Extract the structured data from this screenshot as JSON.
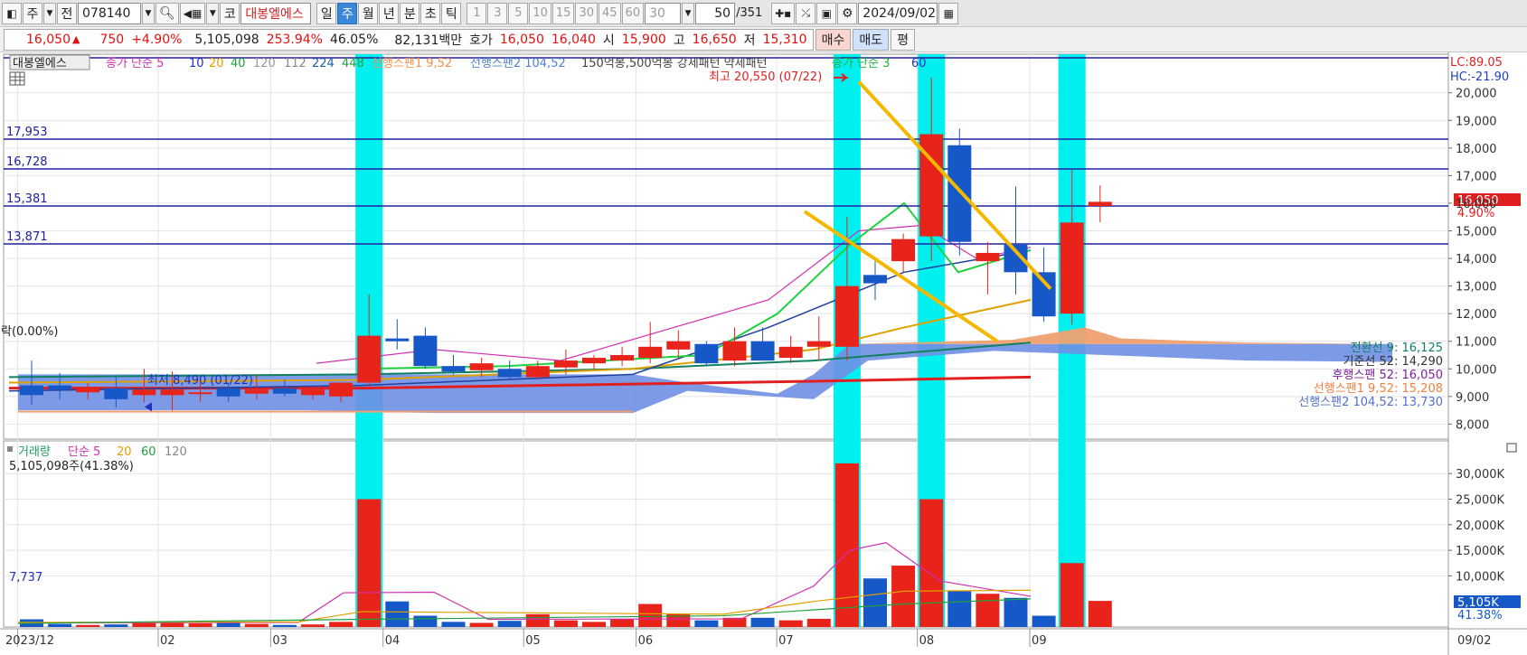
{
  "toolbar": {
    "period_label": "주",
    "mode_label": "전",
    "code": "078140",
    "market_label": "코",
    "stock_name": "대봉엘에스",
    "timeframes": [
      "일",
      "주",
      "월",
      "년",
      "분",
      "초",
      "틱"
    ],
    "active_timeframe": "주",
    "intervals": [
      "1",
      "3",
      "5",
      "10",
      "15",
      "30",
      "45",
      "60"
    ],
    "interval_input": "30",
    "count": "50",
    "total": "/351",
    "date": "2024/09/02"
  },
  "quote": {
    "price": "16,050",
    "arrow": "▲",
    "change": "750",
    "change_pct": "+4.90%",
    "volume": "5,105,098",
    "volume_ratio": "253.94%",
    "turnover": "46.05%",
    "amount": "82,131백만",
    "ask_label": "호가",
    "ask": "16,050",
    "bid": "16,040",
    "open_label": "시",
    "open": "15,900",
    "high_label": "고",
    "high": "16,650",
    "low_label": "저",
    "low": "15,310",
    "buy_label": "매수",
    "sell_label": "매도",
    "eval_label": "평"
  },
  "legend": {
    "stock_tag": "대봉엘에스",
    "ma_label": "종가 단순 5",
    "ma_periods": [
      "10",
      "20",
      "40",
      "120",
      "112",
      "224",
      "448"
    ],
    "span1": "선행스팬1 9,52",
    "span2": "선행스팬2 104,52",
    "pattern": "150억봉,500억봉 강세패턴  약세패턴",
    "ma2_label": "종가 단순 3",
    "ma2_period": "60",
    "side_note": "락(0.00%)"
  },
  "right_top": {
    "lc": "LC:89.05",
    "hc": "HC:-21.90"
  },
  "colors": {
    "up": "#e8231a",
    "down": "#1658c8",
    "highlight": "#00f0f0",
    "hline": "#2020a0",
    "trendline": "#f5b800",
    "cloud_blue": "#6f8fe4",
    "cloud_orange": "#f0a070"
  },
  "hlines": [
    {
      "label": "17,953"
    },
    {
      "label": "16,728"
    },
    {
      "label": "15,381"
    },
    {
      "label": "13,871"
    }
  ],
  "annotations": {
    "max_label": "최고 20,550 (07/22)",
    "min_label": "최저 8,490 (01/22)",
    "price_tag": "16,050",
    "price_pct": "4.90%",
    "volume_tag": "5,105K",
    "volume_pct": "41.38%",
    "volume_low": "7,737"
  },
  "ichimoku_labels": [
    {
      "text": "전환선 9: 16,125",
      "color": "#108060"
    },
    {
      "text": "기준선 52: 14,290",
      "color": "#333333"
    },
    {
      "text": "후행스팬 52: 16,050",
      "color": "#8020a0"
    },
    {
      "text": "선행스팬1 9,52: 15,208",
      "color": "#f08040"
    },
    {
      "text": "선행스팬2 104,52: 13,730",
      "color": "#5070d0"
    }
  ],
  "volume_legend": {
    "label": "거래량",
    "ma_label": "단순 5",
    "periods": [
      "20",
      "60",
      "120"
    ],
    "current": "5,105,098주(41.38%)"
  },
  "price_axis": [
    "20,000",
    "19,000",
    "18,000",
    "17,000",
    "16,000",
    "15,000",
    "14,000",
    "13,000",
    "12,000",
    "11,000",
    "10,000",
    "9,000",
    "8,000"
  ],
  "volume_axis": [
    "30,000K",
    "25,000K",
    "20,000K",
    "15,000K",
    "10,000K"
  ],
  "x_axis": [
    "2023/12",
    "02",
    "03",
    "04",
    "05",
    "06",
    "07",
    "08",
    "09"
  ],
  "x_axis_right": "09/02",
  "chart_data": {
    "type": "candlestick",
    "period": "weekly",
    "ylim": [
      7600,
      21000
    ],
    "candles": [
      {
        "o": 9400,
        "h": 10300,
        "l": 8700,
        "c": 9050
      },
      {
        "o": 9400,
        "h": 9850,
        "l": 8900,
        "c": 9250
      },
      {
        "o": 9150,
        "h": 9500,
        "l": 8900,
        "c": 9300
      },
      {
        "o": 9300,
        "h": 9700,
        "l": 8600,
        "c": 8900
      },
      {
        "o": 9050,
        "h": 10000,
        "l": 8800,
        "c": 9250
      },
      {
        "o": 9050,
        "h": 9900,
        "l": 8490,
        "c": 9250
      },
      {
        "o": 9100,
        "h": 9500,
        "l": 8800,
        "c": 9150
      },
      {
        "o": 9300,
        "h": 9500,
        "l": 8800,
        "c": 9000
      },
      {
        "o": 9100,
        "h": 9800,
        "l": 8900,
        "c": 9250
      },
      {
        "o": 9300,
        "h": 9600,
        "l": 9000,
        "c": 9100
      },
      {
        "o": 9050,
        "h": 9300,
        "l": 8900,
        "c": 9250
      },
      {
        "o": 9000,
        "h": 9400,
        "l": 8800,
        "c": 9500
      },
      {
        "o": 9500,
        "h": 12700,
        "l": 9300,
        "c": 11200
      },
      {
        "o": 11100,
        "h": 11800,
        "l": 10700,
        "c": 11000
      },
      {
        "o": 11200,
        "h": 11500,
        "l": 10000,
        "c": 10100
      },
      {
        "o": 10100,
        "h": 10500,
        "l": 9800,
        "c": 9900
      },
      {
        "o": 9950,
        "h": 10400,
        "l": 9700,
        "c": 10200
      },
      {
        "o": 10000,
        "h": 10300,
        "l": 9600,
        "c": 9700
      },
      {
        "o": 9700,
        "h": 10300,
        "l": 9600,
        "c": 10100
      },
      {
        "o": 10050,
        "h": 10700,
        "l": 9800,
        "c": 10300
      },
      {
        "o": 10200,
        "h": 10500,
        "l": 10000,
        "c": 10400
      },
      {
        "o": 10300,
        "h": 10800,
        "l": 10100,
        "c": 10500
      },
      {
        "o": 10400,
        "h": 11700,
        "l": 10200,
        "c": 10800
      },
      {
        "o": 10700,
        "h": 11400,
        "l": 10400,
        "c": 11000
      },
      {
        "o": 10900,
        "h": 11000,
        "l": 10100,
        "c": 10200
      },
      {
        "o": 10300,
        "h": 11500,
        "l": 10100,
        "c": 11000
      },
      {
        "o": 11000,
        "h": 11500,
        "l": 10300,
        "c": 10300
      },
      {
        "o": 10400,
        "h": 11200,
        "l": 10200,
        "c": 10800
      },
      {
        "o": 10800,
        "h": 11900,
        "l": 10300,
        "c": 11000
      },
      {
        "o": 10800,
        "h": 15500,
        "l": 10300,
        "c": 13000
      },
      {
        "o": 13400,
        "h": 13900,
        "l": 12500,
        "c": 13100
      },
      {
        "o": 13900,
        "h": 14900,
        "l": 13500,
        "c": 14700
      },
      {
        "o": 14800,
        "h": 20550,
        "l": 13900,
        "c": 18500
      },
      {
        "o": 18100,
        "h": 18700,
        "l": 14100,
        "c": 14600
      },
      {
        "o": 13900,
        "h": 14600,
        "l": 12700,
        "c": 14200
      },
      {
        "o": 14500,
        "h": 16600,
        "l": 12700,
        "c": 13500
      },
      {
        "o": 13500,
        "h": 14400,
        "l": 11700,
        "c": 11900
      },
      {
        "o": 12000,
        "h": 17200,
        "l": 11600,
        "c": 15300
      },
      {
        "o": 15900,
        "h": 16650,
        "l": 15310,
        "c": 16050
      }
    ],
    "volume_k": [
      1500,
      600,
      400,
      500,
      1000,
      1000,
      700,
      800,
      600,
      400,
      500,
      1000,
      25000,
      5000,
      2200,
      1000,
      800,
      1200,
      2500,
      1300,
      1000,
      1500,
      4500,
      2500,
      1300,
      1800,
      1800,
      1300,
      1600,
      32000,
      9500,
      12000,
      25000,
      7000,
      6500,
      5700,
      2200,
      12500,
      5105
    ],
    "highlight_weeks": [
      12,
      29,
      32,
      37
    ]
  }
}
